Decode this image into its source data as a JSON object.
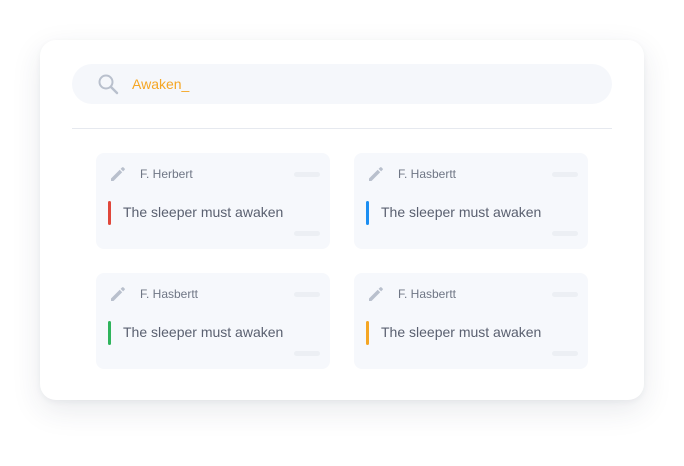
{
  "search": {
    "value": "Awaken_",
    "icon": "search-icon"
  },
  "colors": {
    "search_text": "#f5a623",
    "accent_red": "#e0473b",
    "accent_blue": "#1b8ef2",
    "accent_green": "#2fb45c",
    "accent_orange": "#f5a623"
  },
  "cards": [
    {
      "author": "F. Herbert",
      "message": "The sleeper must awaken",
      "icon": "pencil-icon",
      "accent": "red"
    },
    {
      "author": "F. Hasbertt",
      "message": "The sleeper must awaken",
      "icon": "pencil-icon",
      "accent": "blue"
    },
    {
      "author": "F. Hasbertt",
      "message": "The sleeper must awaken",
      "icon": "pencil-icon",
      "accent": "green"
    },
    {
      "author": "F. Hasbertt",
      "message": "The sleeper must awaken",
      "icon": "pencil-icon",
      "accent": "orange"
    }
  ]
}
